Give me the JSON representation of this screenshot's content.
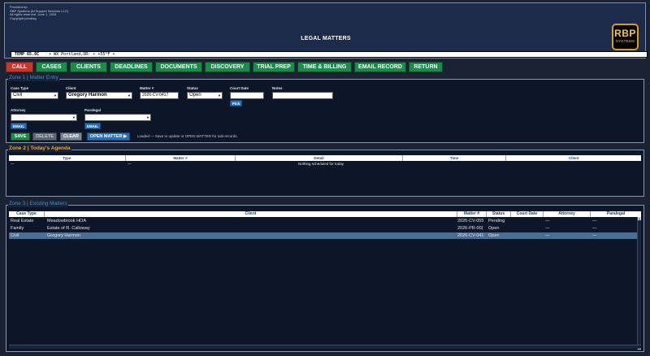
{
  "header": {
    "provided_lines": [
      "Provided by:",
      "RBP Systems (Al Support Services LLC)",
      "All rights reserved. June 1, 2026",
      "Copyright pending."
    ],
    "title": "LEGAL MATTERS",
    "logo_main": "RBP",
    "logo_sub": "SYSTEMS",
    "temp": "TEMP 65.0C",
    "weather": "• WX Portland,OR: •  +55°F  •"
  },
  "nav": [
    "CALL",
    "CASES",
    "CLIENTS",
    "DEADLINES",
    "DOCUMENTS",
    "DISCOVERY",
    "TRIAL PREP",
    "TIME & BILLING",
    "EMAIL RECORD",
    "RETURN"
  ],
  "zone1": {
    "legend": "Zone 1 | Matter Entry",
    "case_type_label": "Case Type",
    "case_type_value": "Civil",
    "client_label": "Client",
    "client_value": "Gregory Harmon",
    "matter_label": "Matter #",
    "matter_value": "2026-CV-0417",
    "status_label": "Status",
    "status_value": "Open",
    "court_date_label": "Court Date",
    "court_date_value": "",
    "pick_label": "Pick",
    "notes_label": "Notes",
    "notes_value": "",
    "attorney_label": "Attorney",
    "paralegal_label": "Paralegal",
    "email_label": "EMAIL",
    "save": "SAVE",
    "delete": "DELETE",
    "clear": "CLEAR",
    "open_matter": "OPEN MATTER ▶",
    "status_msg": "Loaded — Save to update or OPEN MATTER for sub-records."
  },
  "zone2": {
    "legend": "Zone 2 | Today's Agenda",
    "columns": [
      "Type",
      "Matter #",
      "Detail",
      "Time",
      "Client"
    ],
    "empty_row": [
      "—",
      "—",
      "Nothing scheduled for today"
    ]
  },
  "zone3": {
    "legend": "Zone 3 | Existing Matters",
    "columns": [
      "Case Type",
      "Client",
      "Matter #",
      "Status",
      "Court Date",
      "Attorney",
      "Paralegal"
    ],
    "rows": [
      [
        "Real Estate",
        "Meadowbrook HOA",
        "2026-CV-055",
        "Pending",
        "",
        "—",
        "—"
      ],
      [
        "Family",
        "Estate of R. Calloway",
        "2026-PR-00(",
        "Open",
        "",
        "—",
        "—"
      ],
      [
        "Civil",
        "Gregory Harmon",
        "2026-CV-041",
        "Open",
        "",
        "—",
        "—"
      ]
    ],
    "selected_index": 2
  },
  "colors": {
    "accent_green": "#1e8a4a",
    "call_red": "#c0392b",
    "zone_orange": "#f0a830",
    "zone_blue": "#3f8fd2",
    "logo_gold": "#d4a017"
  }
}
